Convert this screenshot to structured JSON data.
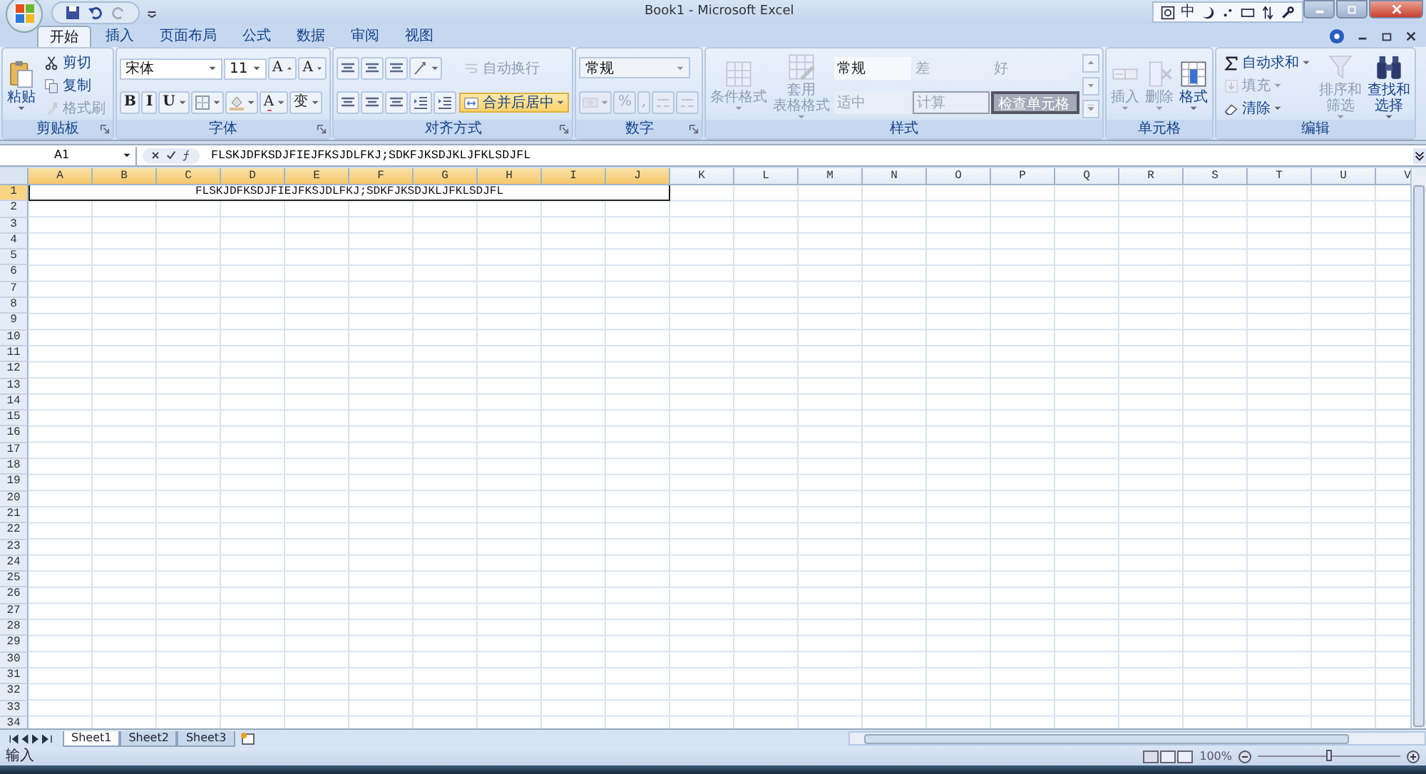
{
  "title_bar": {
    "title": "Book1 - Microsoft Excel",
    "ime_label": "中"
  },
  "ribbon": {
    "tabs": [
      {
        "label": "开始",
        "selected": true
      },
      {
        "label": "插入",
        "selected": false
      },
      {
        "label": "页面布局",
        "selected": false
      },
      {
        "label": "公式",
        "selected": false
      },
      {
        "label": "数据",
        "selected": false
      },
      {
        "label": "审阅",
        "selected": false
      },
      {
        "label": "视图",
        "selected": false
      }
    ],
    "groups": [
      {
        "name": "剪贴板",
        "launcher": true,
        "columns": [
          [
            [
              {
                "kind": "large",
                "lines": [
                  "粘贴"
                ],
                "dropdown": true,
                "disabled": false
              }
            ]
          ],
          [
            [
              {
                "kind": "small",
                "label": "剪切",
                "disabled": false
              }
            ],
            [
              {
                "kind": "small",
                "label": "复制",
                "disabled": false
              }
            ],
            [
              {
                "kind": "small",
                "label": "格式刷",
                "disabled": true
              }
            ]
          ]
        ]
      },
      {
        "name": "字体",
        "launcher": true,
        "columns": [
          [
            [
              {
                "kind": "combo",
                "value": "宋体",
                "disabled": false
              },
              {
                "kind": "combo",
                "value": "11",
                "disabled": false
              },
              {
                "kind": "glyph",
                "label": "A",
                "disabled": false
              },
              {
                "kind": "glyph",
                "label": "A",
                "disabled": false
              }
            ],
            [
              {
                "kind": "glyph",
                "label": "B",
                "disabled": false
              },
              {
                "kind": "glyph",
                "label": "I",
                "disabled": false
              },
              {
                "kind": "glyph",
                "label": "U",
                "dropdown": true,
                "disabled": false
              },
              {
                "kind": "tool",
                "dropdown": true,
                "disabled": false
              },
              {
                "kind": "tool",
                "dropdown": true,
                "disabled": false
              },
              {
                "kind": "glyph",
                "label": "A",
                "dropdown": true,
                "disabled": false
              },
              {
                "kind": "glyph",
                "label": "变",
                "dropdown": true,
                "disabled": false
              }
            ]
          ]
        ]
      },
      {
        "name": "对齐方式",
        "launcher": true,
        "columns": [
          [
            [
              {
                "kind": "tool",
                "disabled": false
              },
              {
                "kind": "tool",
                "disabled": false
              },
              {
                "kind": "tool",
                "disabled": false
              },
              {
                "kind": "tool",
                "dropdown": true,
                "disabled": false
              }
            ],
            [
              {
                "kind": "tool",
                "disabled": false
              },
              {
                "kind": "tool",
                "disabled": false
              },
              {
                "kind": "tool",
                "disabled": false
              },
              {
                "kind": "tool",
                "disabled": false
              },
              {
                "kind": "tool",
                "disabled": false
              }
            ]
          ],
          [
            [
              {
                "kind": "small",
                "label": "自动换行",
                "disabled": true,
                "highlighted": false
              }
            ],
            [
              {
                "kind": "small",
                "label": "合并后居中",
                "dropdown": true,
                "disabled": false,
                "highlighted": true
              }
            ]
          ]
        ]
      },
      {
        "name": "数字",
        "launcher": true,
        "columns": [
          [
            [
              {
                "kind": "combo",
                "value": "常规",
                "disabled": true
              }
            ],
            [
              {
                "kind": "tool",
                "dropdown": true,
                "disabled": true
              },
              {
                "kind": "glyph",
                "label": "%",
                "disabled": true
              },
              {
                "kind": "glyph",
                "label": ",",
                "disabled": true
              },
              {
                "kind": "tool",
                "disabled": true
              },
              {
                "kind": "tool",
                "disabled": true
              }
            ]
          ]
        ]
      },
      {
        "name": "样式",
        "launcher": false,
        "columns": [
          [
            [
              {
                "kind": "large",
                "lines": [
                  "条件格式"
                ],
                "dropdown": true,
                "disabled": true
              }
            ]
          ],
          [
            [
              {
                "kind": "large",
                "lines": [
                  "套用",
                  "表格格式"
                ],
                "dropdown": true,
                "disabled": true
              }
            ]
          ],
          [
            [
              {
                "kind": "cellstyle",
                "label": "常规",
                "disabled": false
              },
              {
                "kind": "cellstyle",
                "label": "差",
                "disabled": true
              },
              {
                "kind": "cellstyle",
                "label": "好",
                "disabled": true
              }
            ],
            [
              {
                "kind": "cellstyle",
                "label": "适中",
                "disabled": true
              },
              {
                "kind": "boxedstyle",
                "label": "计算",
                "disabled": true
              },
              {
                "kind": "filledstyle",
                "label": "检查单元格",
                "disabled": true
              }
            ]
          ],
          [
            [
              {
                "kind": "scroll",
                "disabled": true
              }
            ],
            [
              {
                "kind": "scroll",
                "disabled": true
              }
            ],
            [
              {
                "kind": "scroll",
                "disabled": true
              }
            ]
          ]
        ]
      },
      {
        "name": "单元格",
        "launcher": false,
        "columns": [
          [
            [
              {
                "kind": "large",
                "lines": [
                  "插入"
                ],
                "dropdown": true,
                "disabled": true
              }
            ]
          ],
          [
            [
              {
                "kind": "large",
                "lines": [
                  "删除"
                ],
                "dropdown": true,
                "disabled": true
              }
            ]
          ],
          [
            [
              {
                "kind": "large",
                "lines": [
                  "格式"
                ],
                "dropdown": true,
                "disabled": false
              }
            ]
          ]
        ]
      },
      {
        "name": "编辑",
        "launcher": false,
        "columns": [
          [
            [
              {
                "kind": "small",
                "label": "自动求和",
                "dropdown": true,
                "disabled": false
              }
            ],
            [
              {
                "kind": "small",
                "label": "填充",
                "dropdown": true,
                "disabled": true
              }
            ],
            [
              {
                "kind": "small",
                "label": "清除",
                "dropdown": true,
                "disabled": false
              }
            ]
          ],
          [
            [
              {
                "kind": "large",
                "lines": [
                  "排序和",
                  "筛选"
                ],
                "dropdown": true,
                "disabled": true
              }
            ]
          ],
          [
            [
              {
                "kind": "large",
                "lines": [
                  "查找和",
                  "选择"
                ],
                "dropdown": true,
                "disabled": false
              }
            ]
          ]
        ]
      }
    ]
  },
  "formula_bar": {
    "name_box": "A1",
    "formula": "FLSKJDFKSDJFIEJFKSJDLFKJ;SDKFJKSDJKLJFKLSDJFL"
  },
  "sheet": {
    "columns": [
      {
        "label": "A",
        "selected": true
      },
      {
        "label": "B",
        "selected": true
      },
      {
        "label": "C",
        "selected": true
      },
      {
        "label": "D",
        "selected": true
      },
      {
        "label": "E",
        "selected": true
      },
      {
        "label": "F",
        "selected": true
      },
      {
        "label": "G",
        "selected": true
      },
      {
        "label": "H",
        "selected": true
      },
      {
        "label": "I",
        "selected": true
      },
      {
        "label": "J",
        "selected": true
      },
      {
        "label": "K",
        "selected": false
      },
      {
        "label": "L",
        "selected": false
      },
      {
        "label": "M",
        "selected": false
      },
      {
        "label": "N",
        "selected": false
      },
      {
        "label": "O",
        "selected": false
      },
      {
        "label": "P",
        "selected": false
      },
      {
        "label": "Q",
        "selected": false
      },
      {
        "label": "R",
        "selected": false
      },
      {
        "label": "S",
        "selected": false
      },
      {
        "label": "T",
        "selected": false
      },
      {
        "label": "U",
        "selected": false
      },
      {
        "label": "V",
        "selected": false
      }
    ],
    "rows": [
      {
        "label": "1",
        "selected": true,
        "merged_text": "FLSKJDFKSDJFIEJFKSJDLFKJ;SDKFJKSDJKLJFKLSDJFL"
      },
      {
        "label": "2",
        "selected": false
      },
      {
        "label": "3",
        "selected": false
      },
      {
        "label": "4",
        "selected": false
      },
      {
        "label": "5",
        "selected": false
      },
      {
        "label": "6",
        "selected": false
      },
      {
        "label": "7",
        "selected": false
      },
      {
        "label": "8",
        "selected": false
      },
      {
        "label": "9",
        "selected": false
      },
      {
        "label": "10",
        "selected": false
      },
      {
        "label": "11",
        "selected": false
      },
      {
        "label": "12",
        "selected": false
      },
      {
        "label": "13",
        "selected": false
      },
      {
        "label": "14",
        "selected": false
      },
      {
        "label": "15",
        "selected": false
      },
      {
        "label": "16",
        "selected": false
      },
      {
        "label": "17",
        "selected": false
      },
      {
        "label": "18",
        "selected": false
      },
      {
        "label": "19",
        "selected": false
      },
      {
        "label": "20",
        "selected": false
      },
      {
        "label": "21",
        "selected": false
      },
      {
        "label": "22",
        "selected": false
      },
      {
        "label": "23",
        "selected": false
      },
      {
        "label": "24",
        "selected": false
      },
      {
        "label": "25",
        "selected": false
      },
      {
        "label": "26",
        "selected": false
      },
      {
        "label": "27",
        "selected": false
      },
      {
        "label": "28",
        "selected": false
      },
      {
        "label": "29",
        "selected": false
      },
      {
        "label": "30",
        "selected": false
      },
      {
        "label": "31",
        "selected": false
      },
      {
        "label": "32",
        "selected": false
      },
      {
        "label": "33",
        "selected": false
      },
      {
        "label": "34",
        "selected": false
      }
    ],
    "tabs": [
      {
        "label": "Sheet1",
        "selected": true
      },
      {
        "label": "Sheet2",
        "selected": false
      },
      {
        "label": "Sheet3",
        "selected": false
      }
    ]
  },
  "status_bar": {
    "mode": "输入",
    "zoom": "100%",
    "zoom_slider": {
      "level": 0.5
    }
  }
}
